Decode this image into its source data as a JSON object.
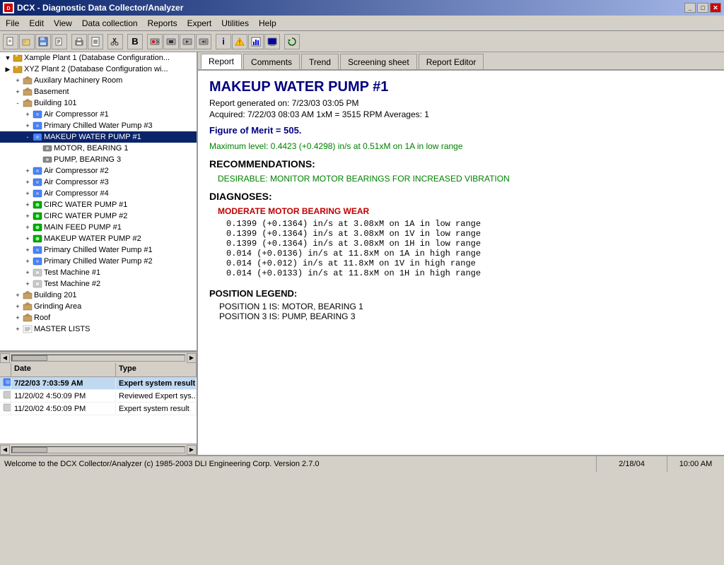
{
  "titlebar": {
    "title": "DCX - Diagnostic Data Collector/Analyzer",
    "icon_label": "DCX",
    "buttons": [
      "minimize",
      "maximize",
      "close"
    ]
  },
  "menubar": {
    "items": [
      "File",
      "Edit",
      "View",
      "Data collection",
      "Reports",
      "Expert",
      "Utilities",
      "Help"
    ]
  },
  "toolbar": {
    "buttons": [
      "new",
      "open",
      "save",
      "print",
      "cut",
      "copy",
      "paste",
      "bold",
      "separator",
      "record",
      "stop",
      "play",
      "rewind",
      "info",
      "alert",
      "chart",
      "screen",
      "refresh"
    ]
  },
  "tabs": {
    "items": [
      "Report",
      "Comments",
      "Trend",
      "Screening sheet",
      "Report Editor"
    ],
    "active": "Report"
  },
  "tree": {
    "items": [
      {
        "id": "xample",
        "label": "Xample Plant 1 (Database Configuration...",
        "level": 0,
        "type": "plant",
        "expanded": true
      },
      {
        "id": "xyz",
        "label": "XYZ Plant 2 (Database Configuration wi...",
        "level": 0,
        "type": "plant",
        "expanded": false
      },
      {
        "id": "aux",
        "label": "Auxilary Machinery Room",
        "level": 1,
        "type": "room",
        "expanded": false
      },
      {
        "id": "basement",
        "label": "Basement",
        "level": 1,
        "type": "room",
        "expanded": false
      },
      {
        "id": "bldg101",
        "label": "Building 101",
        "level": 1,
        "type": "building",
        "expanded": true
      },
      {
        "id": "aircomp1",
        "label": "Air Compressor #1",
        "level": 2,
        "type": "machine",
        "expanded": false
      },
      {
        "id": "prichwp3",
        "label": "Primary Chilled Water Pump #3",
        "level": 2,
        "type": "pump",
        "expanded": false
      },
      {
        "id": "makeup1",
        "label": "MAKEUP WATER PUMP #1",
        "level": 2,
        "type": "pump",
        "expanded": true,
        "selected": true
      },
      {
        "id": "motor1",
        "label": "MOTOR, BEARING 1",
        "level": 3,
        "type": "bearing"
      },
      {
        "id": "pump3",
        "label": "PUMP, BEARING 3",
        "level": 3,
        "type": "bearing"
      },
      {
        "id": "aircomp2",
        "label": "Air Compressor #2",
        "level": 2,
        "type": "machine",
        "expanded": false
      },
      {
        "id": "aircomp3",
        "label": "Air Compressor #3",
        "level": 2,
        "type": "machine",
        "expanded": false
      },
      {
        "id": "aircomp4",
        "label": "Air Compressor #4",
        "level": 2,
        "type": "machine",
        "expanded": false
      },
      {
        "id": "circwp1",
        "label": "CIRC WATER PUMP #1",
        "level": 2,
        "type": "pump",
        "expanded": false
      },
      {
        "id": "circwp2",
        "label": "CIRC WATER PUMP #2",
        "level": 2,
        "type": "pump",
        "expanded": false
      },
      {
        "id": "mainfeed",
        "label": "MAIN FEED PUMP #1",
        "level": 2,
        "type": "pump",
        "expanded": false
      },
      {
        "id": "makeup2",
        "label": "MAKEUP WATER PUMP #2",
        "level": 2,
        "type": "pump",
        "expanded": false
      },
      {
        "id": "prichwp1",
        "label": "Primary Chilled Water Pump #1",
        "level": 2,
        "type": "pump",
        "expanded": false
      },
      {
        "id": "prichwp2",
        "label": "Primary Chilled Water Pump #2",
        "level": 2,
        "type": "pump",
        "expanded": false
      },
      {
        "id": "testmach1",
        "label": "Test Machine #1",
        "level": 2,
        "type": "machine",
        "expanded": false
      },
      {
        "id": "testmach2",
        "label": "Test Machine #2",
        "level": 2,
        "type": "machine",
        "expanded": false
      },
      {
        "id": "bldg201",
        "label": "Building 201",
        "level": 1,
        "type": "building",
        "expanded": false
      },
      {
        "id": "grinding",
        "label": "Grinding Area",
        "level": 1,
        "type": "room",
        "expanded": false
      },
      {
        "id": "roof",
        "label": "Roof",
        "level": 1,
        "type": "room",
        "expanded": false
      },
      {
        "id": "masterlists",
        "label": "MASTER LISTS",
        "level": 1,
        "type": "list",
        "expanded": false
      }
    ]
  },
  "report": {
    "title": "MAKEUP WATER PUMP #1",
    "generated": "Report generated on: 7/23/03 03:05 PM",
    "acquired": "Acquired:  7/22/03 08:03 AM   1xM = 3515 RPM   Averages: 1",
    "fom_label": "Figure of Merit =",
    "fom_value": "505.",
    "max_level": "Maximum level: 0.4423 (+0.4298) in/s at 0.51xM on 1A in low range",
    "recommendations_header": "RECOMMENDATIONS:",
    "desirable": "DESIRABLE:  MONITOR MOTOR BEARINGS FOR INCREASED VIBRATION",
    "diagnoses_header": "DIAGNOSES:",
    "diagnoses_subheader": "MODERATE MOTOR BEARING WEAR",
    "diagnoses_lines": [
      "     0.1399  (+0.1364)  in/s at  3.08xM on  1A in low range",
      "     0.1399  (+0.1364)  in/s at  3.08xM on  1V in low range",
      "     0.1399  (+0.1364)  in/s at  3.08xM on  1H in low range",
      "     0.014  (+0.0136)  in/s at  11.8xM on  1A in high range",
      "     0.014  (+0.012)   in/s at  11.8xM on  1V in high range",
      "     0.014  (+0.0133)  in/s at  11.8xM on  1H in high range"
    ],
    "position_legend_header": "POSITION LEGEND:",
    "position_lines": [
      "POSITION 1 IS:  MOTOR, BEARING 1",
      "POSITION 3 IS:  PUMP, BEARING 3"
    ]
  },
  "bottom_table": {
    "col_date": "Date",
    "col_type": "Type",
    "rows": [
      {
        "date": "7/22/03 7:03:59 AM",
        "type": "Expert system result",
        "highlight": true
      },
      {
        "date": "11/20/02 4:50:09 PM",
        "type": "Reviewed Expert sys...",
        "highlight": false
      },
      {
        "date": "11/20/02 4:50:09 PM",
        "type": "Expert system result",
        "highlight": false
      }
    ]
  },
  "statusbar": {
    "message": "Welcome to the DCX Collector/Analyzer  (c) 1985-2003 DLI Engineering Corp.  Version 2.7.0",
    "date": "2/18/04",
    "time": "10:00 AM"
  }
}
